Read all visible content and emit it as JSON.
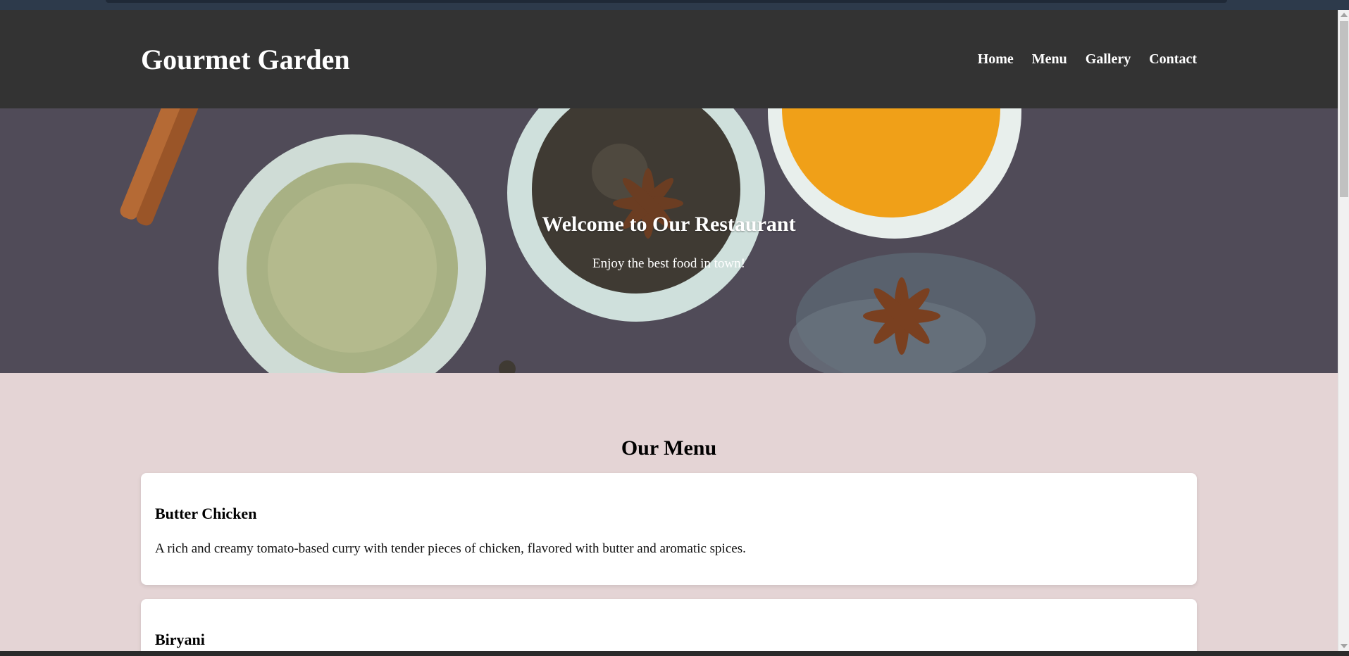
{
  "header": {
    "logo": "Gourmet Garden",
    "nav": [
      "Home",
      "Menu",
      "Gallery",
      "Contact"
    ]
  },
  "hero": {
    "title": "Welcome to Our Restaurant",
    "subtitle": "Enjoy the best food in town!"
  },
  "menu": {
    "title": "Our Menu",
    "items": [
      {
        "name": "Butter Chicken",
        "description": "A rich and creamy tomato-based curry with tender pieces of chicken, flavored with butter and aromatic spices."
      },
      {
        "name": "Biryani",
        "description": ""
      }
    ]
  },
  "colors": {
    "header_bg": "#333333",
    "page_bg": "#e4d4d5",
    "hero_bg": "#504b58",
    "turmeric": "#f0a018"
  }
}
